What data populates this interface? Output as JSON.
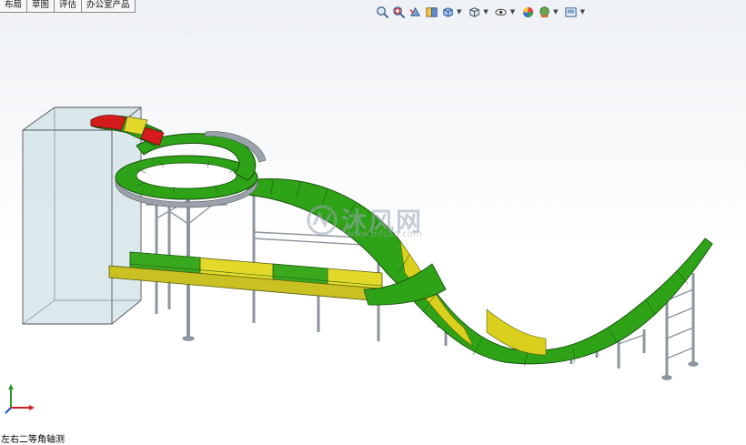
{
  "tabs": [
    {
      "label": "布局"
    },
    {
      "label": "草图"
    },
    {
      "label": "评估"
    },
    {
      "label": "办公室产品"
    }
  ],
  "toolbar": {
    "icons": [
      "zoom-to-fit-icon",
      "zoom-area-icon",
      "previous-view-icon",
      "section-view-icon",
      "view-orientation-icon",
      "display-style-icon",
      "hide-show-items-icon",
      "edit-appearance-icon",
      "apply-scene-icon",
      "view-settings-icon"
    ]
  },
  "viewport": {
    "view_name": "左右二等角轴测",
    "watermark_title": "沐风网",
    "watermark_sub": "www.mfcad.com",
    "colors": {
      "green": "#2ea317",
      "yellow": "#d9d01e",
      "red": "#d41c1c",
      "steel": "#9aa3ab",
      "tower": "#cfe2e6"
    }
  }
}
